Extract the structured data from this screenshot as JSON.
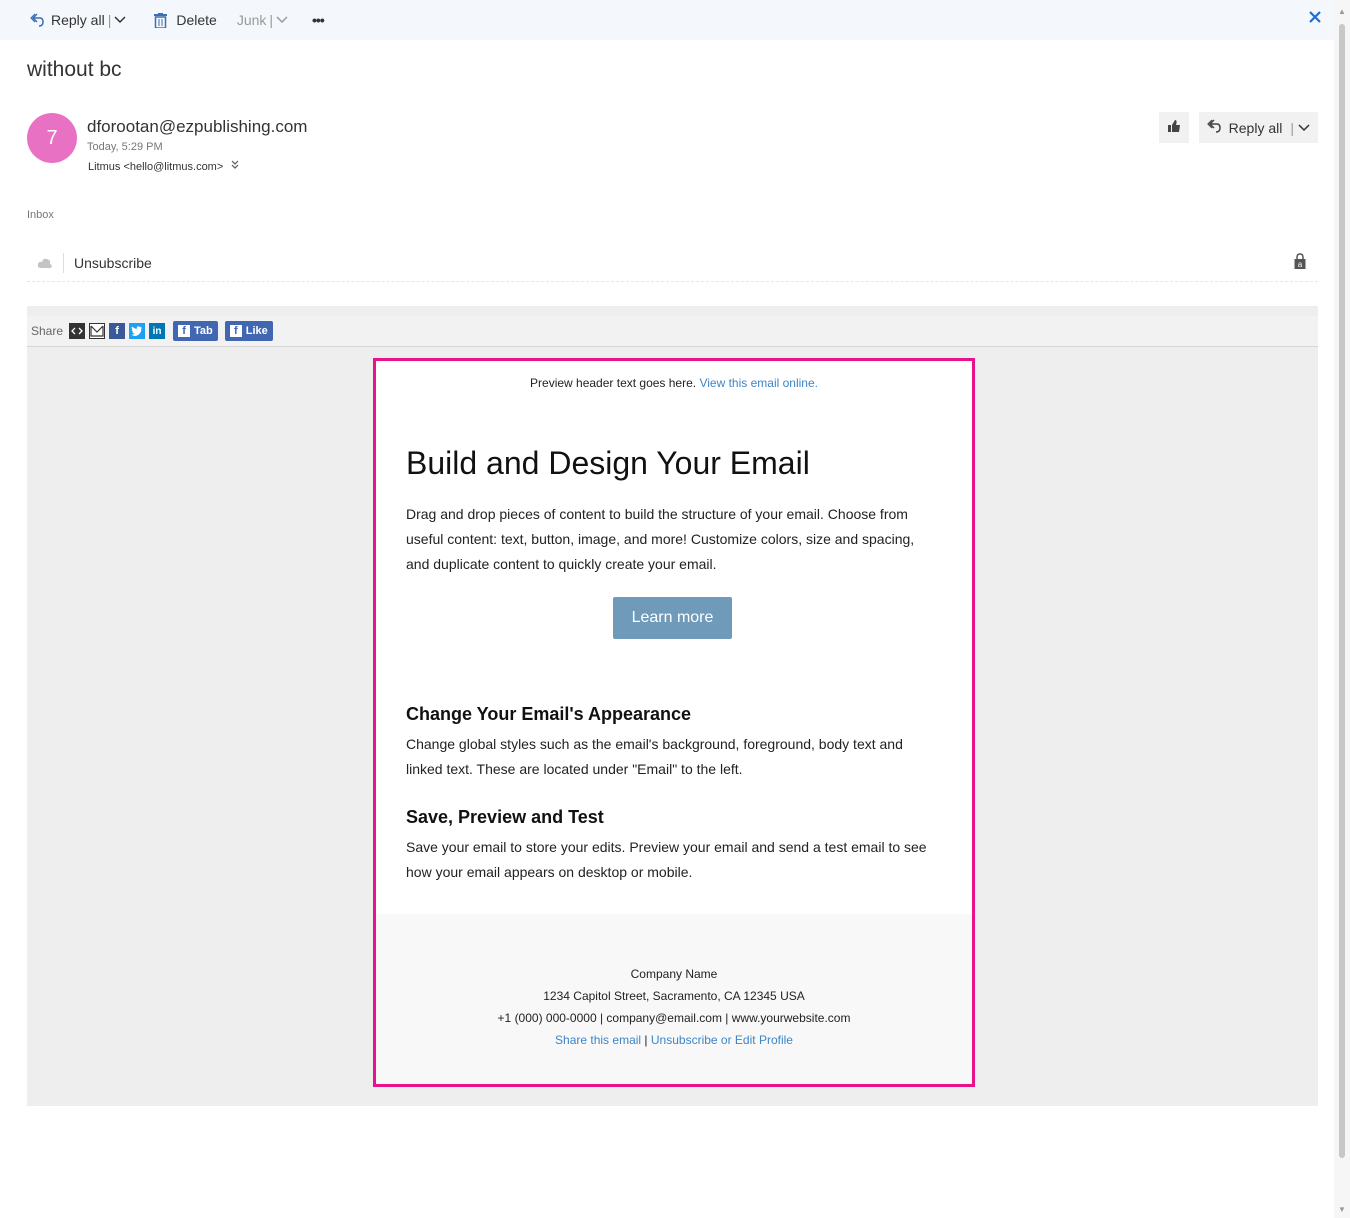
{
  "toolbar": {
    "reply_all": "Reply all",
    "delete": "Delete",
    "junk": "Junk",
    "more": "•••"
  },
  "message": {
    "subject": "without bc",
    "avatar_initial": "7",
    "avatar_color": "#e871c4",
    "sender": "dforootan@ezpublishing.com",
    "date": "Today, 5:29 PM",
    "to": "Litmus <hello@litmus.com>",
    "reply_all": "Reply all",
    "folder": "Inbox",
    "unsubscribe": "Unsubscribe"
  },
  "share": {
    "label": "Share",
    "tab": "Tab",
    "like": "Like"
  },
  "email": {
    "preheader": "Preview header text goes here.",
    "preheader_link": "View this email online.",
    "headline": "Build and Design Your Email",
    "intro": "Drag and drop pieces of content to build the structure of your email. Choose from useful content: text, button, image, and more! Customize colors, size and spacing, and duplicate content to quickly create your email.",
    "cta": "Learn more",
    "section1_title": "Change Your Email's Appearance",
    "section1_body": "Change global styles such as the email's background, foreground, body text and linked text. These are located under \"Email\" to the left.",
    "section2_title": "Save, Preview and Test",
    "section2_body": "Save your email to store your edits. Preview your email and send a test email to see how your email appears on desktop or mobile.",
    "border_color": "#e8128c",
    "cta_color": "#6f9ab9"
  },
  "footer": {
    "company": "Company Name",
    "address": "1234 Capitol Street, Sacramento, CA 12345 USA",
    "contact": "+1 (000) 000-0000 | company@email.com | www.yourwebsite.com",
    "share_link": "Share this email",
    "separator": "|",
    "unsub_link": "Unsubscribe or Edit Profile"
  }
}
